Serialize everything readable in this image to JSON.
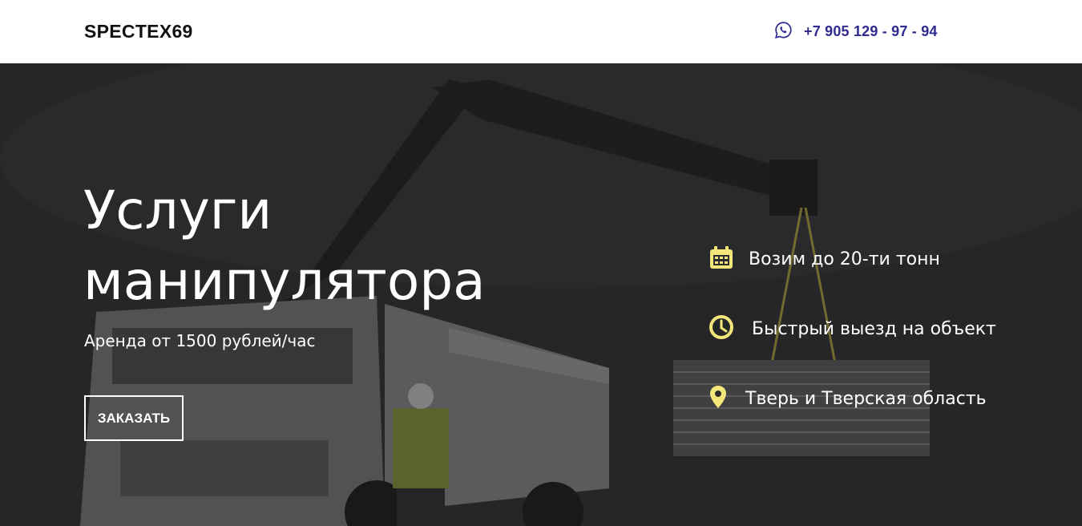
{
  "header": {
    "logo": "SPECTEX69",
    "phone": "+7 905 129 - 97 - 94",
    "phone_icon": "whatsapp-icon"
  },
  "hero": {
    "title": "Услуги манипулятора",
    "subtitle": "Аренда от 1500 рублей/час",
    "cta_label": "ЗАКАЗАТЬ"
  },
  "features": [
    {
      "label": "Возим до 20-ти тонн",
      "icon": "calendar-icon"
    },
    {
      "label": "Быстрый выезд на объект",
      "icon": "clock-icon"
    },
    {
      "label": "Тверь и Тверская область",
      "icon": "location-pin-icon"
    }
  ],
  "colors": {
    "accent_icon": "#f3e77a",
    "phone_text": "#2f2a8f",
    "header_bg": "#ffffff",
    "hero_overlay": "#2b2c2e"
  }
}
